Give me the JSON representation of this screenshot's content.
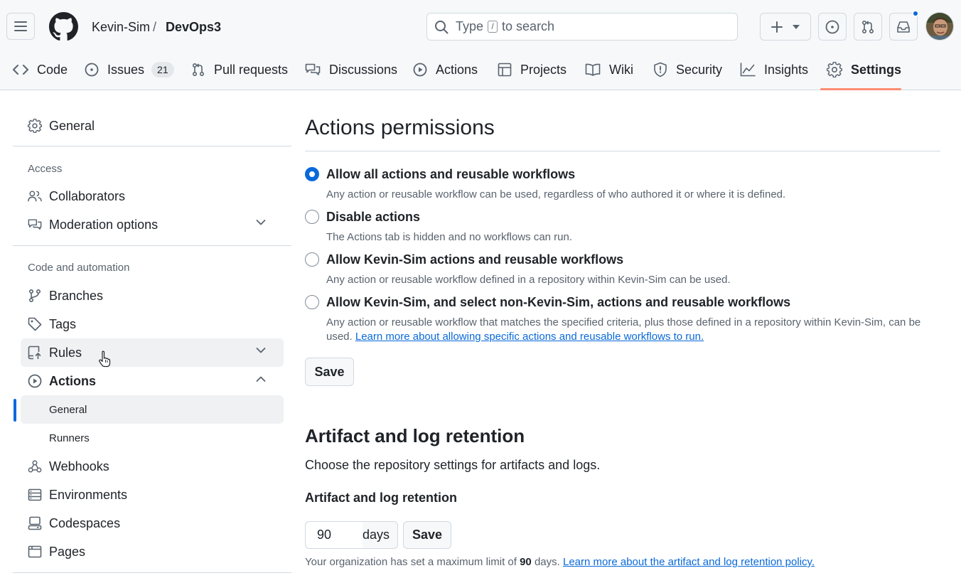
{
  "header": {
    "owner": "Kevin-Sim",
    "separator": "/",
    "repo": "DevOps3",
    "search": {
      "prefix": "Type",
      "key": "/",
      "suffix": "to search"
    }
  },
  "nav": {
    "items": [
      {
        "label": "Code",
        "icon": "code-icon"
      },
      {
        "label": "Issues",
        "icon": "issue-opened-icon",
        "count": "21"
      },
      {
        "label": "Pull requests",
        "icon": "git-pull-request-icon"
      },
      {
        "label": "Discussions",
        "icon": "comment-discussion-icon"
      },
      {
        "label": "Actions",
        "icon": "play-icon"
      },
      {
        "label": "Projects",
        "icon": "table-icon"
      },
      {
        "label": "Wiki",
        "icon": "book-icon"
      },
      {
        "label": "Security",
        "icon": "shield-icon"
      },
      {
        "label": "Insights",
        "icon": "graph-icon"
      },
      {
        "label": "Settings",
        "icon": "gear-icon",
        "active": true
      }
    ]
  },
  "sidebar": {
    "general": "General",
    "access_heading": "Access",
    "collaborators": "Collaborators",
    "moderation": "Moderation options",
    "code_heading": "Code and automation",
    "branches": "Branches",
    "tags": "Tags",
    "rules": "Rules",
    "actions": "Actions",
    "actions_general": "General",
    "actions_runners": "Runners",
    "webhooks": "Webhooks",
    "environments": "Environments",
    "codespaces": "Codespaces",
    "pages": "Pages"
  },
  "permissions": {
    "title": "Actions permissions",
    "options": [
      {
        "label": "Allow all actions and reusable workflows",
        "desc": "Any action or reusable workflow can be used, regardless of who authored it or where it is defined.",
        "checked": true
      },
      {
        "label": "Disable actions",
        "desc": "The Actions tab is hidden and no workflows can run.",
        "checked": false
      },
      {
        "label": "Allow Kevin-Sim actions and reusable workflows",
        "desc": "Any action or reusable workflow defined in a repository within Kevin-Sim can be used.",
        "checked": false
      },
      {
        "label": "Allow Kevin-Sim, and select non-Kevin-Sim, actions and reusable workflows",
        "desc": "Any action or reusable workflow that matches the specified criteria, plus those defined in a repository within Kevin-Sim, can be used.",
        "link": "Learn more about allowing specific actions and reusable workflows to run.",
        "checked": false
      }
    ],
    "save": "Save"
  },
  "retention": {
    "title": "Artifact and log retention",
    "desc": "Choose the repository settings for artifacts and logs.",
    "field_label": "Artifact and log retention",
    "value": "90",
    "unit": "days",
    "save": "Save",
    "note_prefix": "Your organization has set a maximum limit of",
    "note_value": "90",
    "note_suffix": "days.",
    "note_link": "Learn more about the artifact and log retention policy."
  },
  "colors": {
    "accent": "#0969da",
    "underline": "#fd8c73",
    "muted": "#59636e"
  }
}
